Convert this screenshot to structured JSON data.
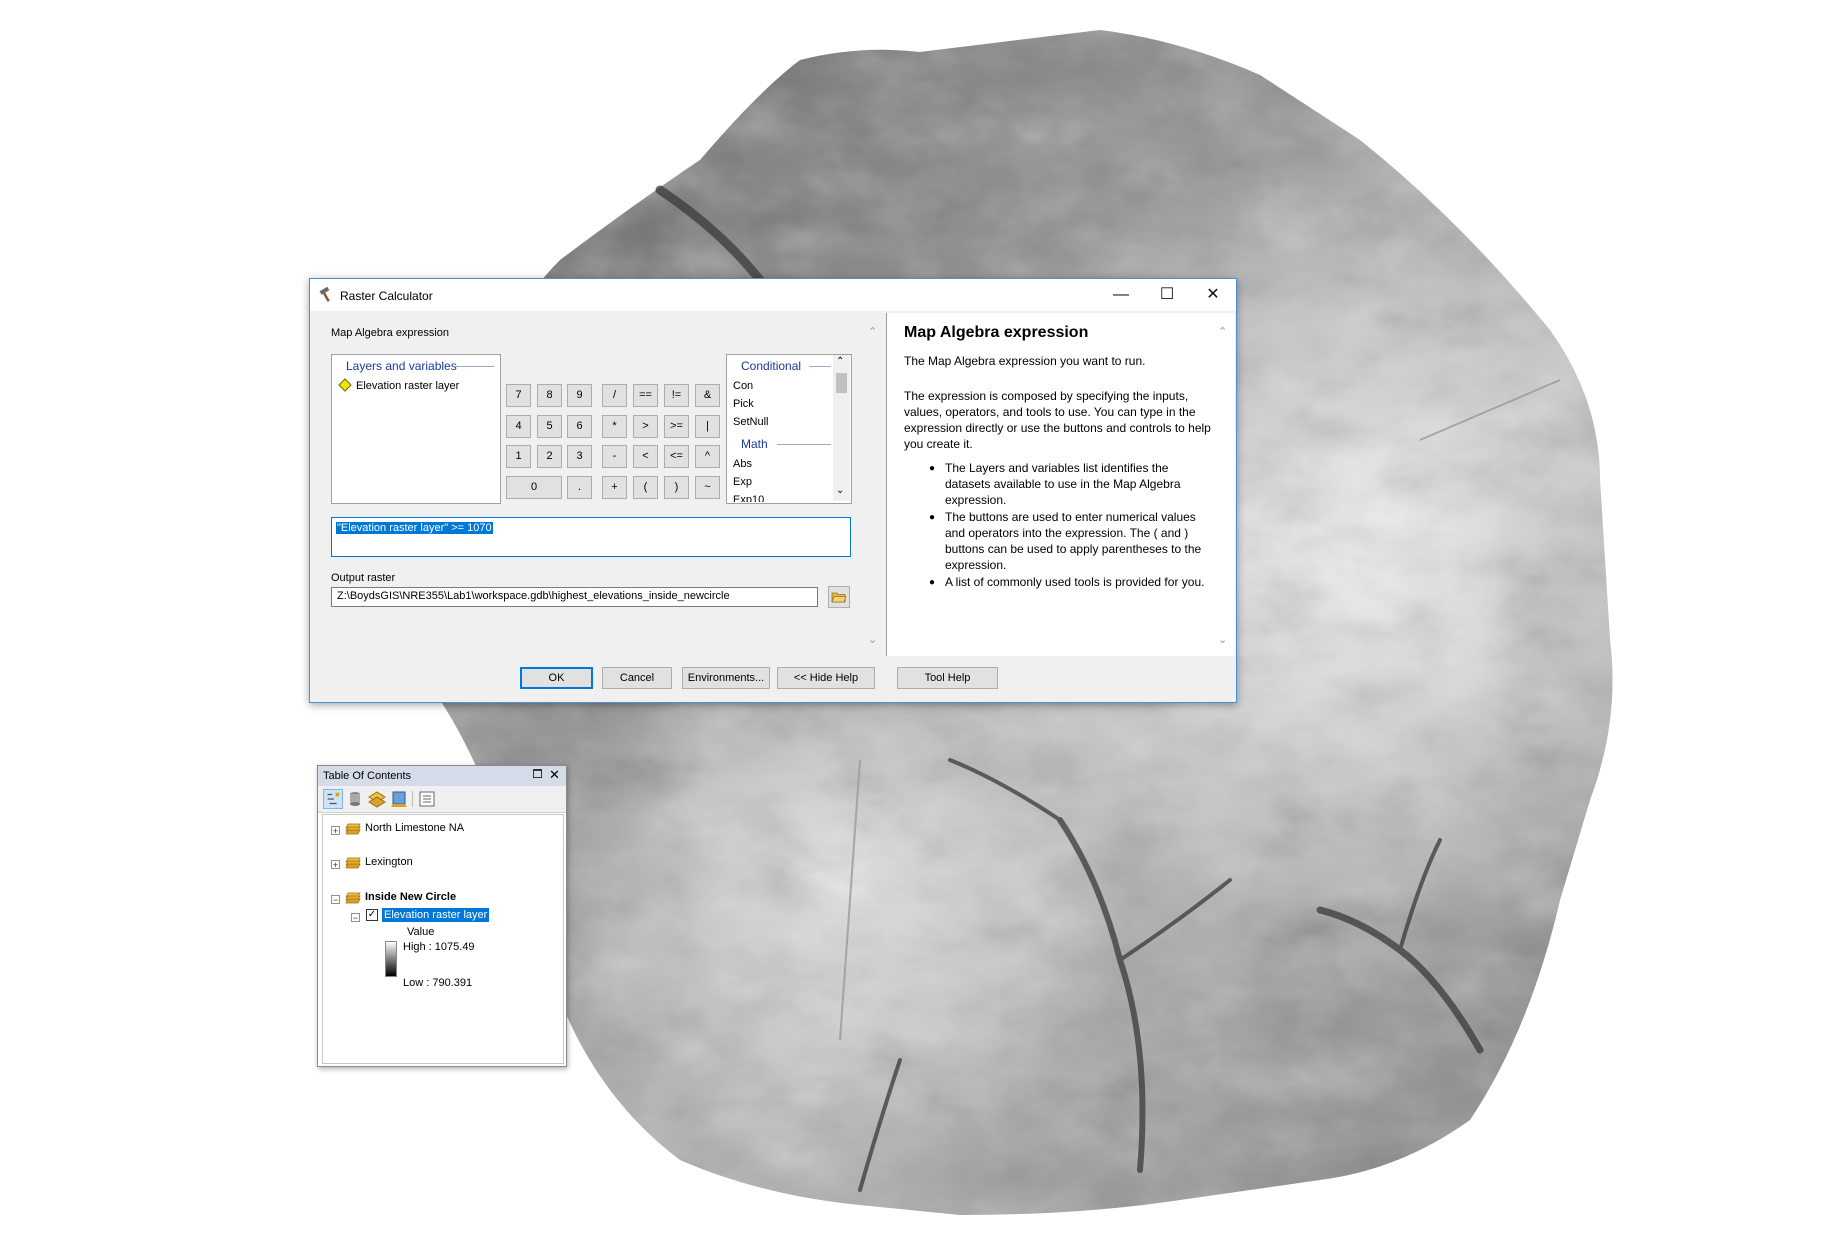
{
  "dialog": {
    "title": "Raster Calculator",
    "window_controls": [
      "—",
      "☐",
      "✕"
    ],
    "expression_label": "Map Algebra expression",
    "layers": {
      "header": "Layers and variables",
      "items": [
        {
          "label": "Elevation raster layer",
          "icon": "diamond-icon",
          "color": "#f2e600"
        }
      ]
    },
    "keypad": {
      "row1": [
        "7",
        "8",
        "9",
        "/",
        "==",
        "!=",
        "&"
      ],
      "row2": [
        "4",
        "5",
        "6",
        "*",
        ">",
        ">=",
        "|"
      ],
      "row3": [
        "1",
        "2",
        "3",
        "-",
        "<",
        "<=",
        "^"
      ],
      "row4": [
        "0",
        ".",
        "+",
        "(",
        ")",
        "~"
      ]
    },
    "tools": {
      "groups": [
        {
          "header": "Conditional",
          "items": [
            "Con",
            "Pick",
            "SetNull"
          ]
        },
        {
          "header": "Math",
          "items": [
            "Abs",
            "Exp",
            "Exp10"
          ]
        }
      ]
    },
    "expression_value": "\"Elevation raster layer\" >= 1070",
    "output_label": "Output raster",
    "output_value": "Z:\\BoydsGIS\\NRE355\\Lab1\\workspace.gdb\\highest_elevations_inside_newcircle",
    "buttons": {
      "ok": "OK",
      "cancel": "Cancel",
      "environments": "Environments...",
      "hide_help": "<< Hide Help",
      "tool_help": "Tool Help"
    },
    "help": {
      "title": "Map Algebra expression",
      "p1": "The Map Algebra expression you want to run.",
      "p2": "The expression is composed by specifying the inputs, values, operators, and tools to use. You can type in the expression directly or use the buttons and controls to help you create it.",
      "bullets": [
        "The Layers and variables list identifies the datasets available to use in the Map Algebra expression.",
        "The buttons are used to enter numerical values and operators into the expression. The ( and ) buttons can be used to apply parentheses to the expression.",
        "A list of commonly used tools is provided for you."
      ]
    }
  },
  "toc": {
    "title": "Table Of Contents",
    "layers": [
      {
        "name": "North Limestone NA",
        "expanded": false
      },
      {
        "name": "Lexington",
        "expanded": false
      },
      {
        "name": "Inside New Circle",
        "expanded": true
      }
    ],
    "sublayer": {
      "name": "Elevation raster layer",
      "checked": true,
      "legend_title": "Value",
      "high": "High : 1075.49",
      "low": "Low : 790.391"
    }
  },
  "colors": {
    "accent": "#0078d7",
    "group_header": "#1a3a9a",
    "toc_title_bg": "#d6dbe9"
  }
}
